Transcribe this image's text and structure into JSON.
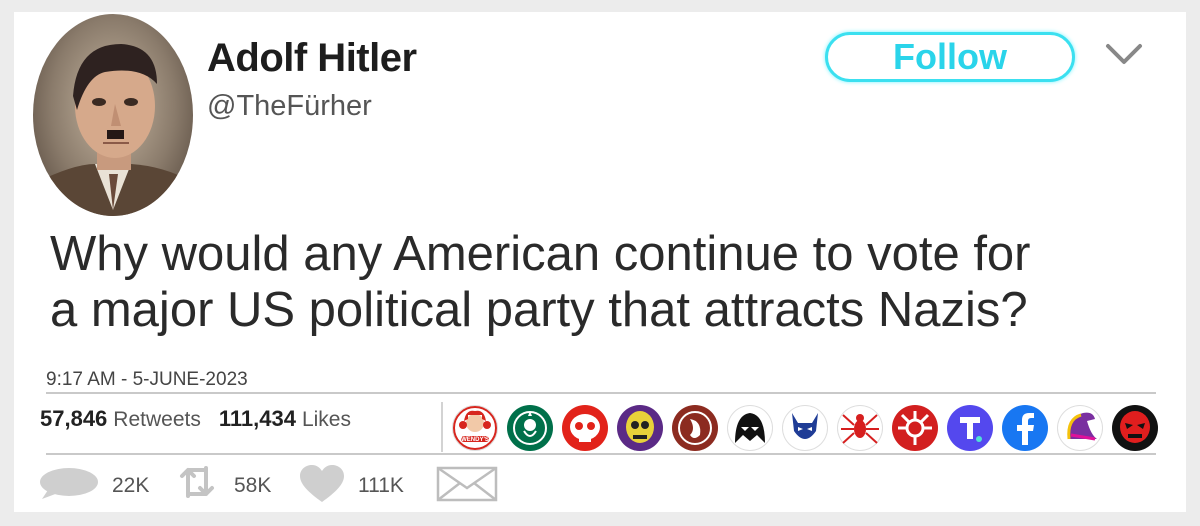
{
  "user": {
    "display_name": "Adolf Hitler",
    "handle": "@TheFürher"
  },
  "header": {
    "follow_label": "Follow",
    "menu_icon": "chevron-down-icon"
  },
  "tweet": {
    "text": "Why would any American continue to vote for\na major US political party that attracts Nazis?",
    "timestamp": "9:17 AM - 5-JUNE-2023"
  },
  "stats": {
    "retweets_count": "57,846",
    "retweets_label": "Retweets",
    "likes_count": "111,434",
    "likes_label": "Likes"
  },
  "likers": [
    {
      "name": "wendys-logo",
      "label": "WENDY'S",
      "bg": "#ffffff",
      "fg": "#d7261e"
    },
    {
      "name": "starbucks-logo",
      "bg": "#00704a",
      "fg": "#ffffff"
    },
    {
      "name": "red-skull-face-icon",
      "bg": "#e2231a",
      "fg": "#ffffff"
    },
    {
      "name": "skeletor-icon",
      "bg": "#5b2a86",
      "fg": "#e8d23a"
    },
    {
      "name": "chipotle-pepper-icon",
      "bg": "#8c2b20",
      "fg": "#ffffff"
    },
    {
      "name": "darth-vader-icon",
      "bg": "#ffffff",
      "fg": "#111111"
    },
    {
      "name": "blue-devil-icon",
      "bg": "#ffffff",
      "fg": "#1f3c96"
    },
    {
      "name": "red-spider-icon",
      "bg": "#ffffff",
      "fg": "#d61f1f"
    },
    {
      "name": "hydra-icon",
      "bg": "#d21f1f",
      "fg": "#ffffff"
    },
    {
      "name": "truth-social-icon",
      "bg": "#5448ee",
      "fg": "#ffffff"
    },
    {
      "name": "facebook-icon",
      "bg": "#1877f2",
      "fg": "#ffffff"
    },
    {
      "name": "taco-bell-bell-icon",
      "bg": "#ffffff",
      "fg": "#7a2fa0"
    },
    {
      "name": "red-skull-villain-icon",
      "bg": "#111111",
      "fg": "#e01e1e"
    }
  ],
  "actions": {
    "reply_count": "22K",
    "retweet_count": "58K",
    "like_count": "111K",
    "message_icon": "envelope-icon"
  },
  "colors": {
    "follow_accent": "#2ad4ea",
    "text": "#2a2a2a",
    "muted": "#555555"
  }
}
